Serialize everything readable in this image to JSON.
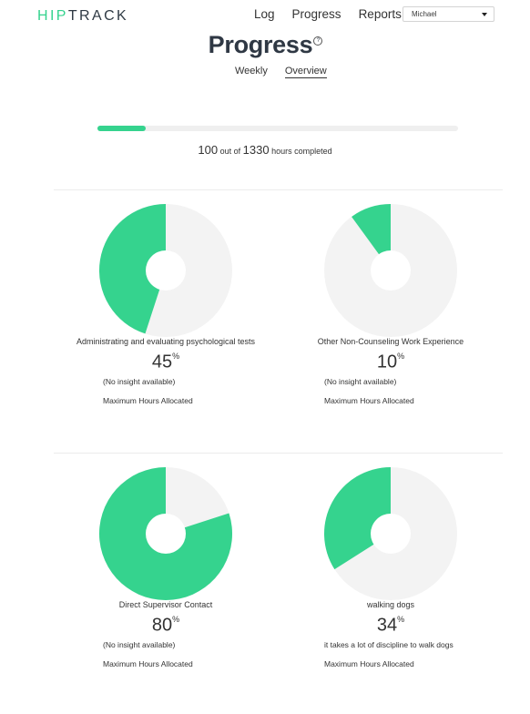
{
  "header": {
    "logo_accent": "HIP",
    "logo_rest": "TRACK",
    "nav": [
      "Log",
      "Progress",
      "Reports"
    ],
    "user_selected": "Michael"
  },
  "page": {
    "title": "Progress",
    "help_icon": "?",
    "tabs": [
      "Weekly",
      "Overview"
    ],
    "active_tab": "Overview"
  },
  "progress": {
    "completed": "100",
    "of_text": "out of",
    "total": "1330",
    "suffix": "hours completed",
    "fraction": 0.1338
  },
  "colors": {
    "accent": "#35d38e",
    "track": "#f3f3f3"
  },
  "categories": [
    {
      "name": "Administrating and evaluating psychological tests",
      "percent": 45,
      "percent_label": "45",
      "insight": "(No insight available)",
      "max_label": "Maximum Hours Allocated"
    },
    {
      "name": "Other Non-Counseling Work Experience",
      "percent": 10,
      "percent_label": "10",
      "insight": "(No insight available)",
      "max_label": "Maximum Hours Allocated"
    },
    {
      "name": "Direct Supervisor Contact",
      "percent": 80,
      "percent_label": "80",
      "insight": "(No insight available)",
      "max_label": "Maximum Hours Allocated"
    },
    {
      "name": "walking dogs",
      "percent": 34,
      "percent_label": "34",
      "insight": "it takes a lot of discipline to walk dogs",
      "max_label": "Maximum Hours Allocated"
    }
  ],
  "percent_sign": "%"
}
